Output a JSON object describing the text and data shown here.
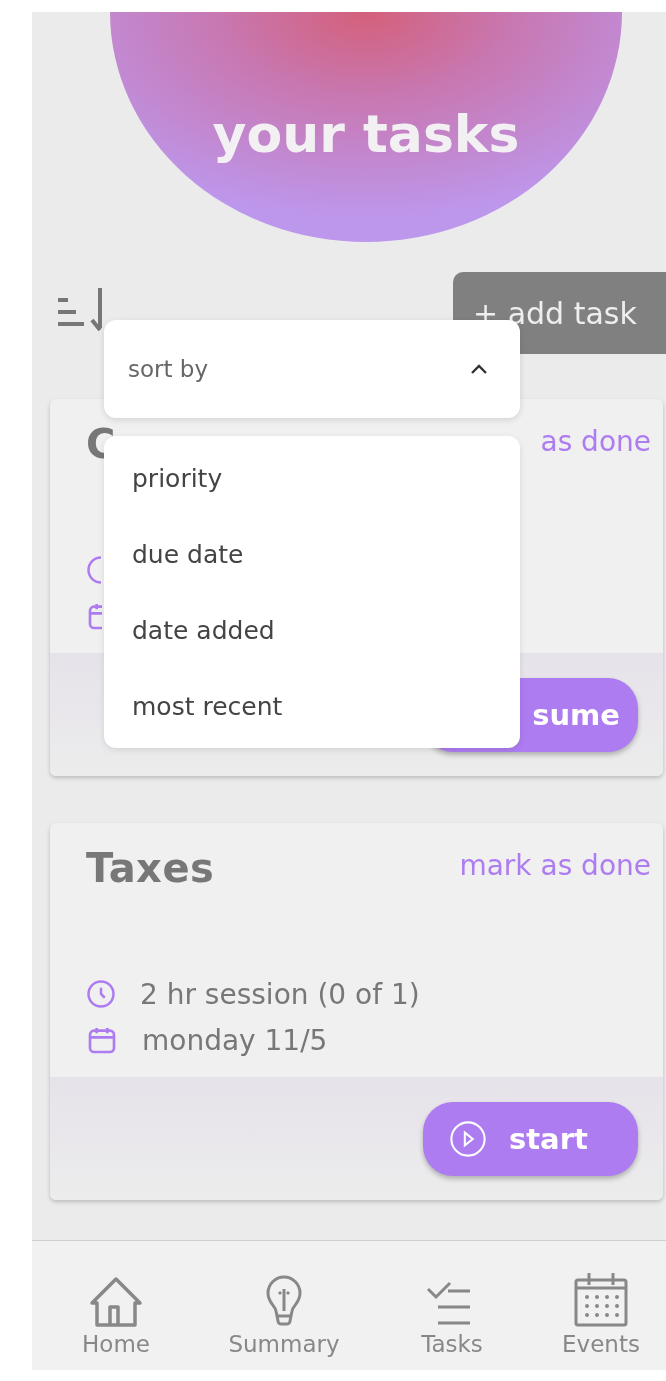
{
  "header": {
    "title": "your tasks"
  },
  "toolbar": {
    "add_task_label": "+ add task"
  },
  "sort_dropdown": {
    "label": "sort by",
    "expanded": true,
    "options": [
      {
        "label": "priority"
      },
      {
        "label": "due date"
      },
      {
        "label": "date added"
      },
      {
        "label": "most recent"
      }
    ]
  },
  "tasks": [
    {
      "title": "C",
      "mark_done": "as done",
      "action_label": "sume"
    },
    {
      "title": "Taxes",
      "mark_done": "mark as done",
      "session": "2 hr session (0 of 1)",
      "due": "monday 11/5",
      "action_label": "start"
    }
  ],
  "nav": [
    {
      "label": "Home",
      "kind": "home"
    },
    {
      "label": "Summary",
      "kind": "summary"
    },
    {
      "label": "Tasks",
      "kind": "tasks"
    },
    {
      "label": "Events",
      "kind": "events"
    }
  ]
}
